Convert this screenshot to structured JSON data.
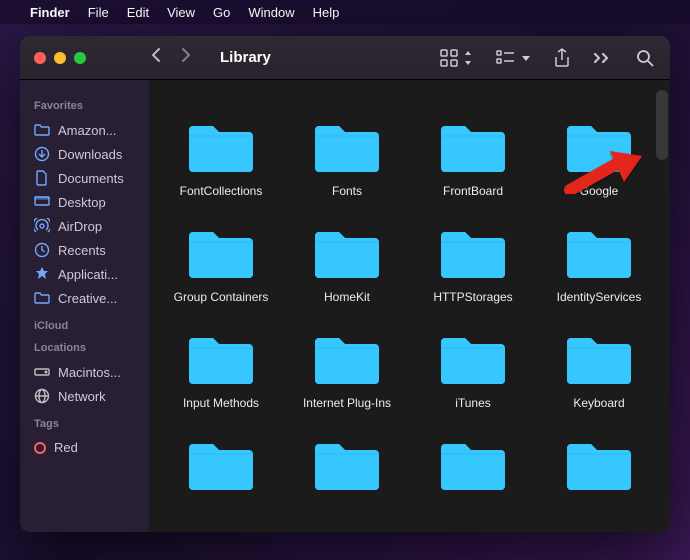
{
  "menubar": {
    "app": "Finder",
    "items": [
      "File",
      "Edit",
      "View",
      "Go",
      "Window",
      "Help"
    ]
  },
  "window": {
    "title": "Library"
  },
  "sidebar": {
    "sections": [
      {
        "label": "Favorites",
        "items": [
          {
            "icon": "folder",
            "text": "Amazon..."
          },
          {
            "icon": "download",
            "text": "Downloads"
          },
          {
            "icon": "doc",
            "text": "Documents"
          },
          {
            "icon": "desktop",
            "text": "Desktop"
          },
          {
            "icon": "airdrop",
            "text": "AirDrop"
          },
          {
            "icon": "clock",
            "text": "Recents"
          },
          {
            "icon": "app",
            "text": "Applicati..."
          },
          {
            "icon": "folder",
            "text": "Creative..."
          }
        ]
      },
      {
        "label": "iCloud",
        "items": []
      },
      {
        "label": "Locations",
        "items": [
          {
            "icon": "disk",
            "text": "Macintos..."
          },
          {
            "icon": "globe",
            "text": "Network"
          }
        ]
      },
      {
        "label": "Tags",
        "items": [
          {
            "icon": "tag",
            "text": "Red",
            "color": "#ff5f57"
          }
        ]
      }
    ]
  },
  "folders": [
    "FontCollections",
    "Fonts",
    "FrontBoard",
    "Google",
    "Group Containers",
    "HomeKit",
    "HTTPStorages",
    "IdentityServices",
    "Input Methods",
    "Internet Plug-Ins",
    "iTunes",
    "Keyboard"
  ],
  "colors": {
    "folder": "#37c7ff",
    "arrow": "#e3281f"
  }
}
